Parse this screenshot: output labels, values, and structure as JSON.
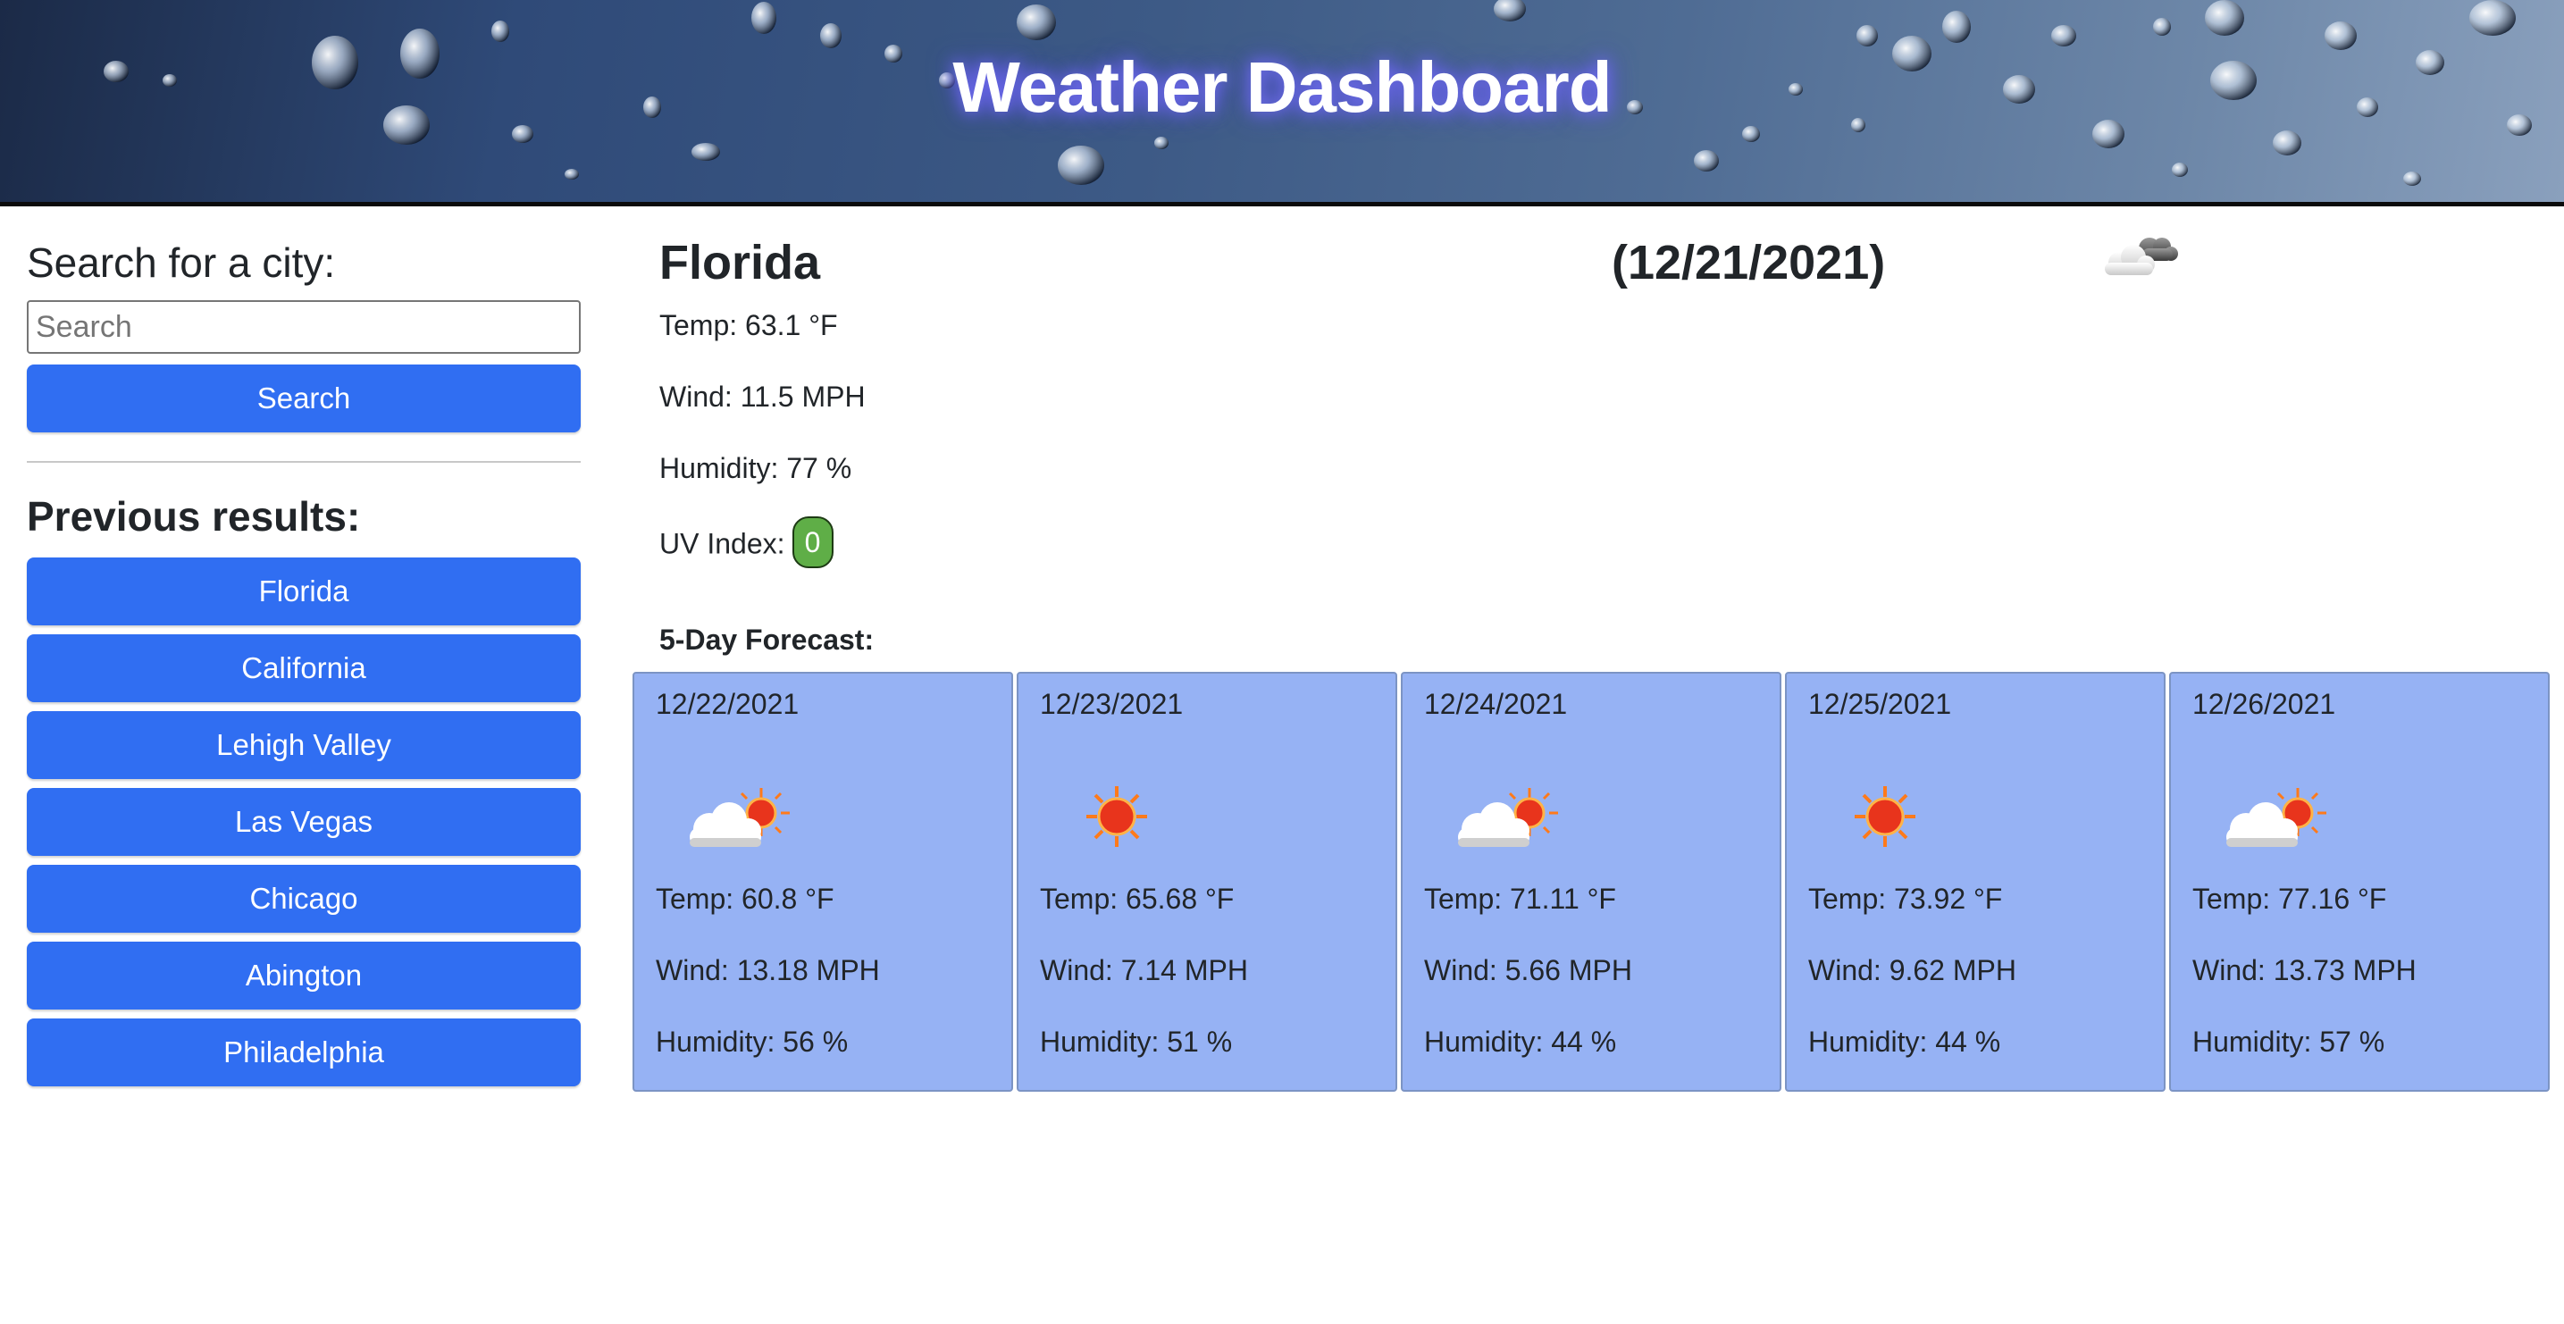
{
  "header": {
    "title": "Weather Dashboard"
  },
  "sidebar": {
    "search_heading": "Search for a city:",
    "search_placeholder": "Search",
    "search_value": "",
    "search_button": "Search",
    "previous_heading": "Previous results:",
    "previous": [
      "Florida",
      "California",
      "Lehigh Valley",
      "Las Vegas",
      "Chicago",
      "Abington",
      "Philadelphia"
    ]
  },
  "current": {
    "city": "Florida",
    "date": "(12/21/2021)",
    "icon": "cloudy-icon",
    "temp": "Temp: 63.1 °F",
    "wind": "Wind: 11.5 MPH",
    "humidity": "Humidity: 77 %",
    "uv_label": "UV Index:",
    "uv_value": "0",
    "uv_color": "#5fae47"
  },
  "forecast": {
    "title": "5-Day Forecast:",
    "card_color": "#96b2f4",
    "days": [
      {
        "date": "12/22/2021",
        "icon": "partly-cloudy-icon",
        "temp": "Temp: 60.8 °F",
        "wind": "Wind: 13.18 MPH",
        "humidity": "Humidity: 56 %"
      },
      {
        "date": "12/23/2021",
        "icon": "sun-icon",
        "temp": "Temp: 65.68 °F",
        "wind": "Wind: 7.14 MPH",
        "humidity": "Humidity: 51 %"
      },
      {
        "date": "12/24/2021",
        "icon": "partly-cloudy-icon",
        "temp": "Temp: 71.11 °F",
        "wind": "Wind: 5.66 MPH",
        "humidity": "Humidity: 44 %"
      },
      {
        "date": "12/25/2021",
        "icon": "sun-icon",
        "temp": "Temp: 73.92 °F",
        "wind": "Wind: 9.62 MPH",
        "humidity": "Humidity: 44 %"
      },
      {
        "date": "12/26/2021",
        "icon": "partly-cloudy-icon",
        "temp": "Temp: 77.16 °F",
        "wind": "Wind: 13.73 MPH",
        "humidity": "Humidity: 57 %"
      }
    ]
  },
  "colors": {
    "accent": "#306ef2",
    "title_glow": "#7a73ff"
  }
}
